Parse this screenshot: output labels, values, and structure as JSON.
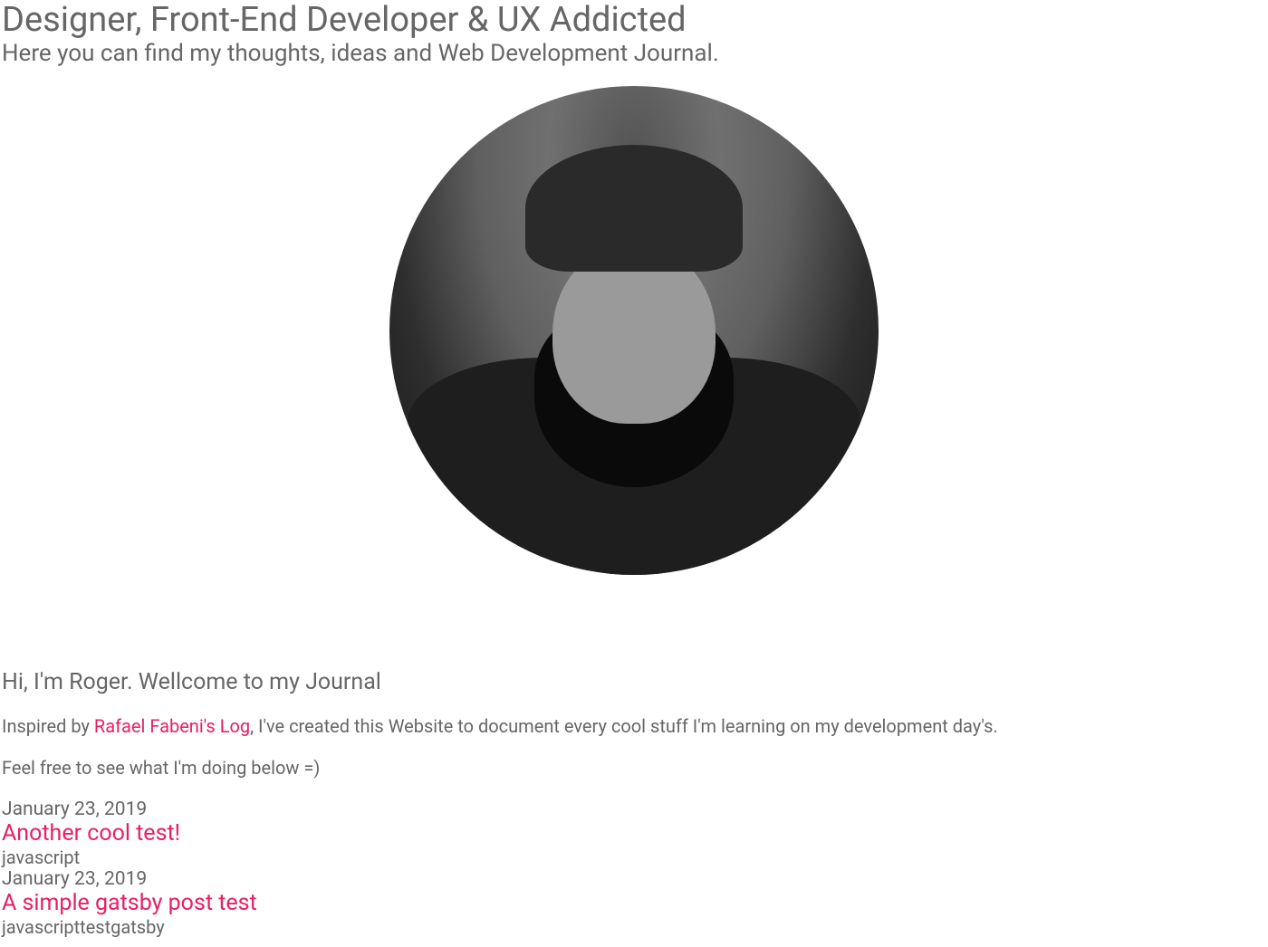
{
  "header": {
    "title": "Designer, Front-End Developer & UX Addicted",
    "subtitle": "Here you can find my thoughts, ideas and Web Development Journal."
  },
  "intro": {
    "greeting": "Hi, I'm Roger. Wellcome to my Journal",
    "inspired_prefix": "Inspired by ",
    "inspired_link": "Rafael Fabeni's Log",
    "inspired_suffix": ", I've created this Website to document every cool stuff I'm learning on my development day's.",
    "feel_free": "Feel free to see what I'm doing below =)"
  },
  "posts": [
    {
      "date": "January 23, 2019",
      "title": "Another cool test!",
      "tags": "javascript"
    },
    {
      "date": "January 23, 2019",
      "title": "A simple gatsby post test",
      "tags": "javascripttestgatsby"
    }
  ]
}
